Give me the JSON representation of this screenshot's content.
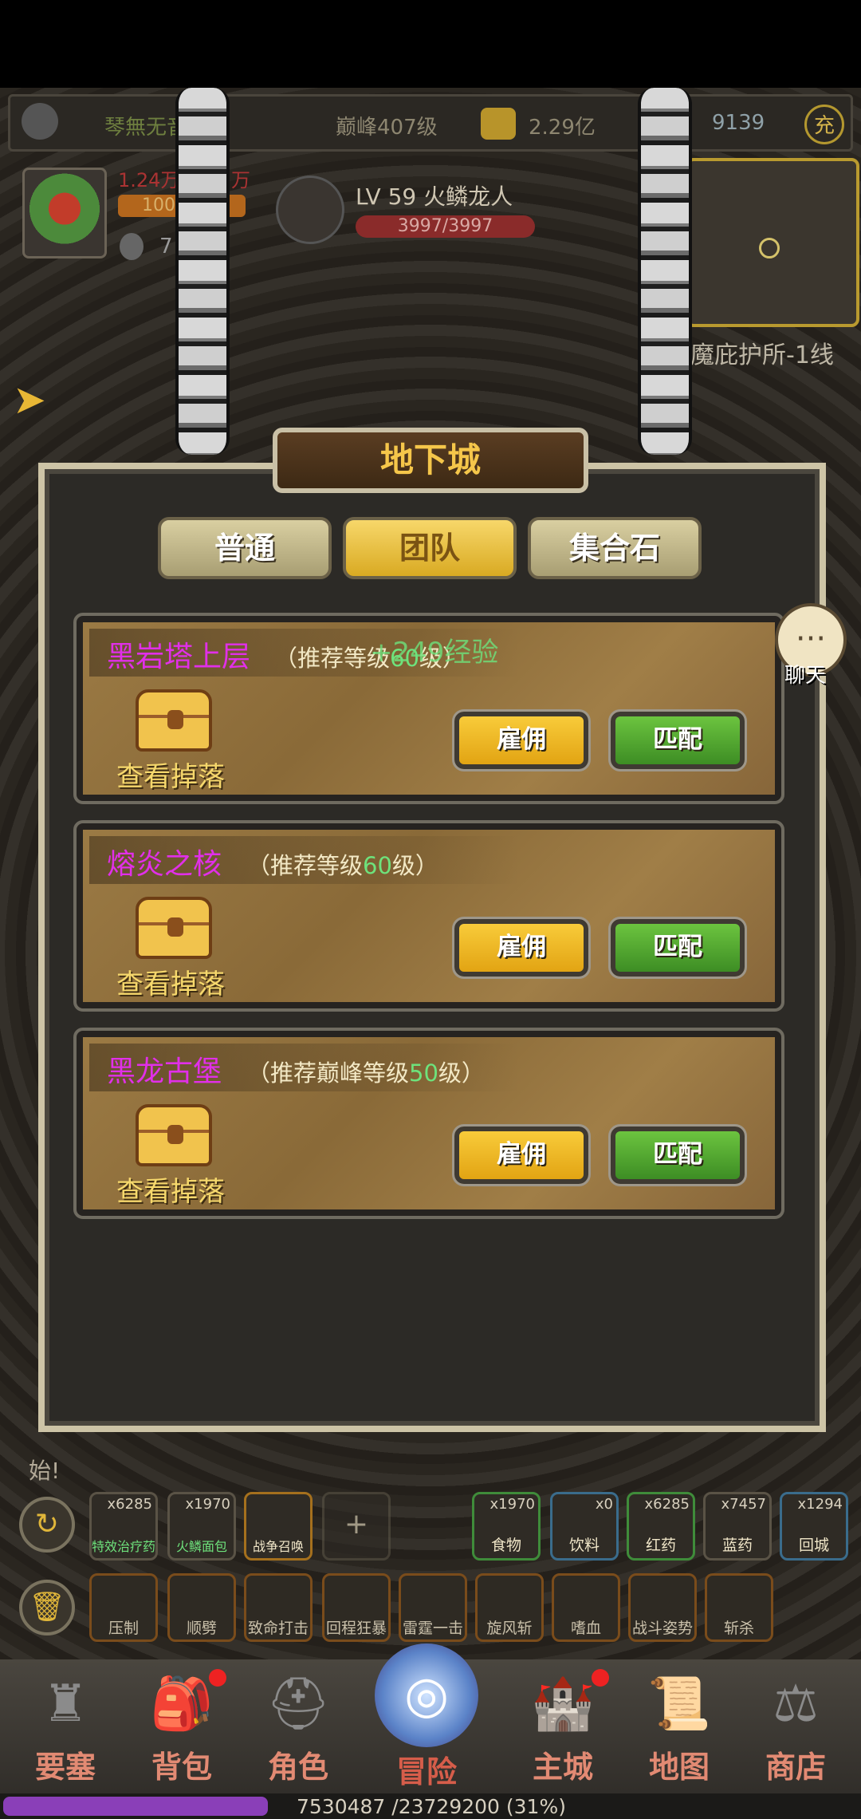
{
  "topbar": {
    "guild": "琴無无音",
    "peak_level": "巅峰407级",
    "gold": "2.29亿",
    "gems": "9139",
    "recharge": "充"
  },
  "player": {
    "power": "1.24万",
    "power_unit": "万",
    "level_short": "100",
    "potion_count": "7"
  },
  "boss": {
    "name": "LV 59 火鳞龙人",
    "hp": "3997/3997"
  },
  "map": {
    "location": "魔庇护所-1线"
  },
  "panel": {
    "title": "地下城",
    "tabs": [
      "普通",
      "团队",
      "集合石"
    ],
    "active_tab": "团队",
    "floating_exp": "+249经验"
  },
  "dungeons": [
    {
      "name": "黑岩塔上层",
      "rec_prefix": "（推荐等级",
      "rec_value": "60",
      "rec_suffix": "级）",
      "drop_label": "查看掉落",
      "hire_label": "雇佣",
      "match_label": "匹配"
    },
    {
      "name": "熔炎之核",
      "rec_prefix": "（推荐等级",
      "rec_value": "60",
      "rec_suffix": "级）",
      "drop_label": "查看掉落",
      "hire_label": "雇佣",
      "match_label": "匹配"
    },
    {
      "name": "黑龙古堡",
      "rec_prefix": "（推荐巅峰等级",
      "rec_value": "50",
      "rec_suffix": "级）",
      "drop_label": "查看掉落",
      "hire_label": "雇佣",
      "match_label": "匹配"
    }
  ],
  "chat": {
    "label": "聊天"
  },
  "log": {
    "text": "始!"
  },
  "consumables_left": [
    {
      "qty": "x6285",
      "name": "特效治疗药"
    },
    {
      "qty": "x1970",
      "name": "火鳞面包"
    },
    {
      "qty": "",
      "name": "战争召唤"
    }
  ],
  "consumables_right": [
    {
      "qty": "x1970",
      "name": "食物"
    },
    {
      "qty": "x0",
      "name": "饮料"
    },
    {
      "qty": "x6285",
      "name": "红药"
    },
    {
      "qty": "x7457",
      "name": "蓝药"
    },
    {
      "qty": "x1294",
      "name": "回城"
    }
  ],
  "skills": [
    "压制",
    "顺劈",
    "致命打击",
    "回程狂暴",
    "雷霆一击",
    "旋风斩",
    "嗜血",
    "战斗姿势",
    "斩杀"
  ],
  "nav": [
    {
      "label": "要塞",
      "icon": "fortress-icon",
      "glyph": "♜"
    },
    {
      "label": "背包",
      "icon": "backpack-icon",
      "glyph": "🎒"
    },
    {
      "label": "角色",
      "icon": "helmet-icon",
      "glyph": "⛑"
    },
    {
      "label": "冒险",
      "icon": "portal-icon",
      "glyph": "◎"
    },
    {
      "label": "主城",
      "icon": "castle-icon",
      "glyph": "🏰"
    },
    {
      "label": "地图",
      "icon": "scroll-icon",
      "glyph": "📜"
    },
    {
      "label": "商店",
      "icon": "shop-icon",
      "glyph": "⚖"
    }
  ],
  "exp": {
    "text": "7530487 /23729200 (31%)",
    "fraction": 0.31
  }
}
